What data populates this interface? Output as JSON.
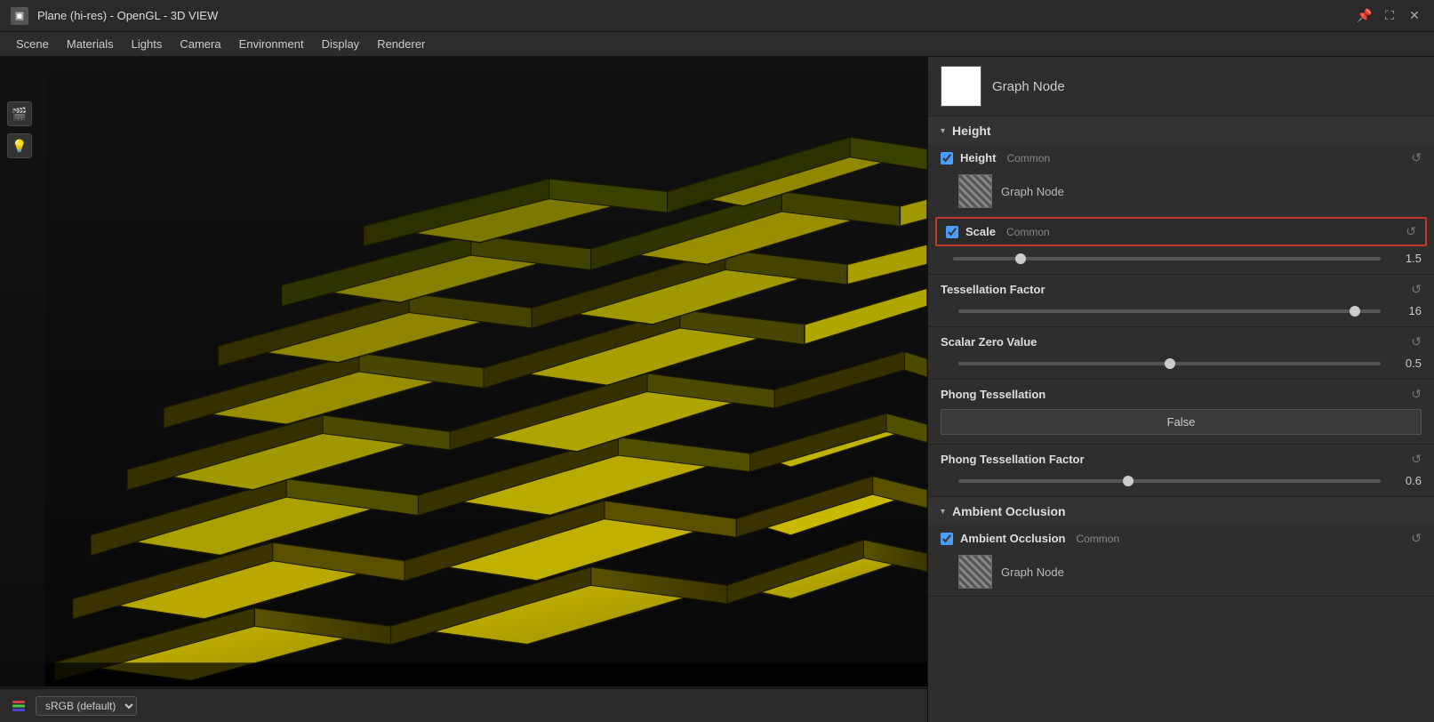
{
  "titlebar": {
    "icon": "▣",
    "title": "Plane (hi-res) - OpenGL - 3D VIEW",
    "pin_icon": "📌",
    "fullscreen_icon": "⛶",
    "close_icon": "✕"
  },
  "menubar": {
    "items": [
      "Scene",
      "Materials",
      "Lights",
      "Camera",
      "Environment",
      "Display",
      "Renderer"
    ]
  },
  "viewport": {
    "bottom_bar": {
      "color_mode": "sRGB (default)"
    }
  },
  "right_panel": {
    "graph_node_header": {
      "label": "Graph Node"
    },
    "height_section": {
      "title": "Height",
      "chevron": "▾",
      "height_property": {
        "name": "Height",
        "common_label": "Common",
        "graph_node_label": "Graph Node",
        "reset_icon": "↺"
      },
      "scale_property": {
        "name": "Scale",
        "common_label": "Common",
        "reset_icon": "↺",
        "slider_value": 1.5,
        "slider_percent": 15
      }
    },
    "tessellation_factor": {
      "name": "Tessellation Factor",
      "reset_icon": "↺",
      "slider_value": 16,
      "slider_percent": 95
    },
    "scalar_zero_value": {
      "name": "Scalar Zero Value",
      "reset_icon": "↺",
      "slider_value": 0.5,
      "slider_percent": 50
    },
    "phong_tessellation": {
      "name": "Phong Tessellation",
      "reset_icon": "↺",
      "dropdown_value": "False"
    },
    "phong_tessellation_factor": {
      "name": "Phong Tessellation Factor",
      "reset_icon": "↺",
      "slider_value": 0.6,
      "slider_percent": 40
    },
    "ambient_occlusion_section": {
      "title": "Ambient Occlusion",
      "chevron": "▾",
      "ao_property": {
        "name": "Ambient Occlusion",
        "common_label": "Common",
        "reset_icon": "↺",
        "graph_node_label": "Graph Node"
      }
    }
  }
}
